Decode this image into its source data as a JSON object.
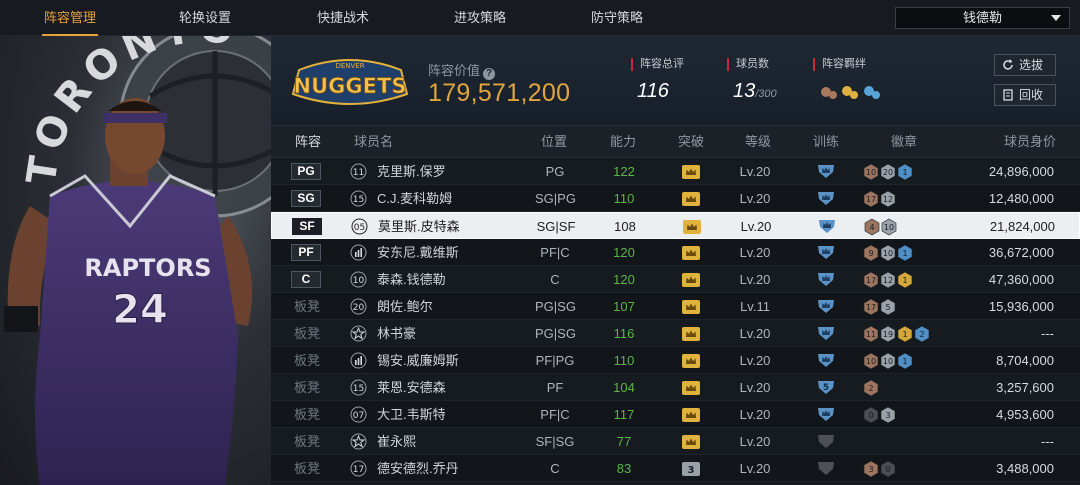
{
  "nav": {
    "tabs": [
      {
        "label": "阵容管理",
        "active": true
      },
      {
        "label": "轮换设置",
        "active": false
      },
      {
        "label": "快捷战术",
        "active": false
      },
      {
        "label": "进攻策略",
        "active": false
      },
      {
        "label": "防守策略",
        "active": false
      }
    ],
    "team_select": "钱德勒"
  },
  "portrait": {
    "background_text": "TORONTO",
    "jersey_text": "RAPTORS",
    "jersey_number": "24"
  },
  "summary": {
    "team_logo_text": "NUGGETS",
    "team_logo_small": "DENVER",
    "lineup_value_label": "阵容价值",
    "lineup_value": "179,571,200",
    "stats": [
      {
        "label": "阵容总评",
        "value": "116",
        "suffix": ""
      },
      {
        "label": "球员数",
        "value": "13",
        "suffix": "/300"
      },
      {
        "label": "阵容羁绊",
        "value": "",
        "suffix": ""
      }
    ],
    "select_button": "选拔",
    "recycle_button": "回收"
  },
  "table": {
    "headers": [
      "阵容",
      "球员名",
      "位置",
      "能力",
      "突破",
      "等级",
      "训练",
      "徽章",
      "球员身价"
    ],
    "rows": [
      {
        "slot": "PG",
        "starter": true,
        "number": "11",
        "name": "克里斯.保罗",
        "position": "PG",
        "ability": "122",
        "break": "crown",
        "level": "Lv.20",
        "train": "crown",
        "badges": [
          {
            "tier": "bronze",
            "n": "10"
          },
          {
            "tier": "silver",
            "n": "20"
          },
          {
            "tier": "blue",
            "n": "1"
          }
        ],
        "value": "24,896,000"
      },
      {
        "slot": "SG",
        "starter": true,
        "number": "15",
        "name": "C.J.麦科勒姆",
        "position": "SG|PG",
        "ability": "110",
        "break": "crown",
        "level": "Lv.20",
        "train": "crown",
        "badges": [
          {
            "tier": "bronze",
            "n": "17"
          },
          {
            "tier": "silver",
            "n": "12"
          }
        ],
        "value": "12,480,000"
      },
      {
        "slot": "SF",
        "starter": true,
        "selected": true,
        "number": "05",
        "name": "莫里斯.皮特森",
        "position": "SG|SF",
        "ability": "108",
        "break": "crown",
        "level": "Lv.20",
        "train": "crown",
        "badges": [
          {
            "tier": "bronze",
            "n": "4"
          },
          {
            "tier": "silver",
            "n": "10"
          }
        ],
        "value": "21,824,000"
      },
      {
        "slot": "PF",
        "starter": true,
        "number": "bars",
        "name": "安东尼.戴维斯",
        "position": "PF|C",
        "ability": "120",
        "break": "crown",
        "level": "Lv.20",
        "train": "crown",
        "badges": [
          {
            "tier": "bronze",
            "n": "9"
          },
          {
            "tier": "silver",
            "n": "10"
          },
          {
            "tier": "blue",
            "n": "1"
          }
        ],
        "value": "36,672,000"
      },
      {
        "slot": "C",
        "starter": true,
        "number": "10",
        "name": "泰森.钱德勒",
        "position": "C",
        "ability": "120",
        "break": "crown",
        "level": "Lv.20",
        "train": "crown",
        "badges": [
          {
            "tier": "bronze",
            "n": "17"
          },
          {
            "tier": "silver",
            "n": "12"
          },
          {
            "tier": "gold",
            "n": "1"
          }
        ],
        "value": "47,360,000"
      },
      {
        "slot": "板凳",
        "starter": false,
        "number": "20",
        "name": "朗佐.鲍尔",
        "position": "PG|SG",
        "ability": "107",
        "break": "crown",
        "level": "Lv.11",
        "train": "crown",
        "badges": [
          {
            "tier": "bronze",
            "n": "17"
          },
          {
            "tier": "silver",
            "n": "5"
          }
        ],
        "value": "15,936,000"
      },
      {
        "slot": "板凳",
        "starter": false,
        "number": "star",
        "name": "林书豪",
        "position": "PG|SG",
        "ability": "116",
        "break": "crown",
        "level": "Lv.20",
        "train": "crown",
        "badges": [
          {
            "tier": "bronze",
            "n": "11"
          },
          {
            "tier": "silver",
            "n": "19"
          },
          {
            "tier": "gold",
            "n": "1"
          },
          {
            "tier": "blue",
            "n": "2"
          }
        ],
        "value": "---"
      },
      {
        "slot": "板凳",
        "starter": false,
        "number": "bars",
        "name": "锡安.威廉姆斯",
        "position": "PF|PG",
        "ability": "110",
        "break": "crown",
        "level": "Lv.20",
        "train": "crown",
        "badges": [
          {
            "tier": "bronze",
            "n": "10"
          },
          {
            "tier": "silver",
            "n": "10"
          },
          {
            "tier": "blue",
            "n": "1"
          }
        ],
        "value": "8,704,000"
      },
      {
        "slot": "板凳",
        "starter": false,
        "number": "15",
        "name": "莱恩.安德森",
        "position": "PF",
        "ability": "104",
        "break": "crown",
        "level": "Lv.20",
        "train": "5",
        "badges": [
          {
            "tier": "bronze",
            "n": "2"
          }
        ],
        "value": "3,257,600"
      },
      {
        "slot": "板凳",
        "starter": false,
        "number": "07",
        "name": "大卫.韦斯特",
        "position": "PF|C",
        "ability": "117",
        "break": "crown",
        "level": "Lv.20",
        "train": "crown",
        "badges": [
          {
            "tier": "dark",
            "n": "0"
          },
          {
            "tier": "silver",
            "n": "3"
          }
        ],
        "value": "4,953,600"
      },
      {
        "slot": "板凳",
        "starter": false,
        "number": "star",
        "name": "崔永熙",
        "position": "SF|SG",
        "ability": "77",
        "break": "crown",
        "level": "Lv.20",
        "train": "grey",
        "badges": [],
        "value": "---"
      },
      {
        "slot": "板凳",
        "starter": false,
        "number": "17",
        "name": "德安德烈.乔丹",
        "position": "C",
        "ability": "83",
        "break": "3",
        "level": "Lv.20",
        "train": "grey",
        "badges": [
          {
            "tier": "bronze",
            "n": "3"
          },
          {
            "tier": "dark",
            "n": "0"
          }
        ],
        "value": "3,488,000"
      }
    ]
  },
  "colors": {
    "accent": "#e8a23a",
    "ability_green": "#5fb449",
    "stat_red": "#c8283a",
    "badge_bronze": "#9c7560",
    "badge_silver": "#9aa1a8",
    "badge_gold": "#d6a73a",
    "badge_blue": "#4e8fc6"
  }
}
